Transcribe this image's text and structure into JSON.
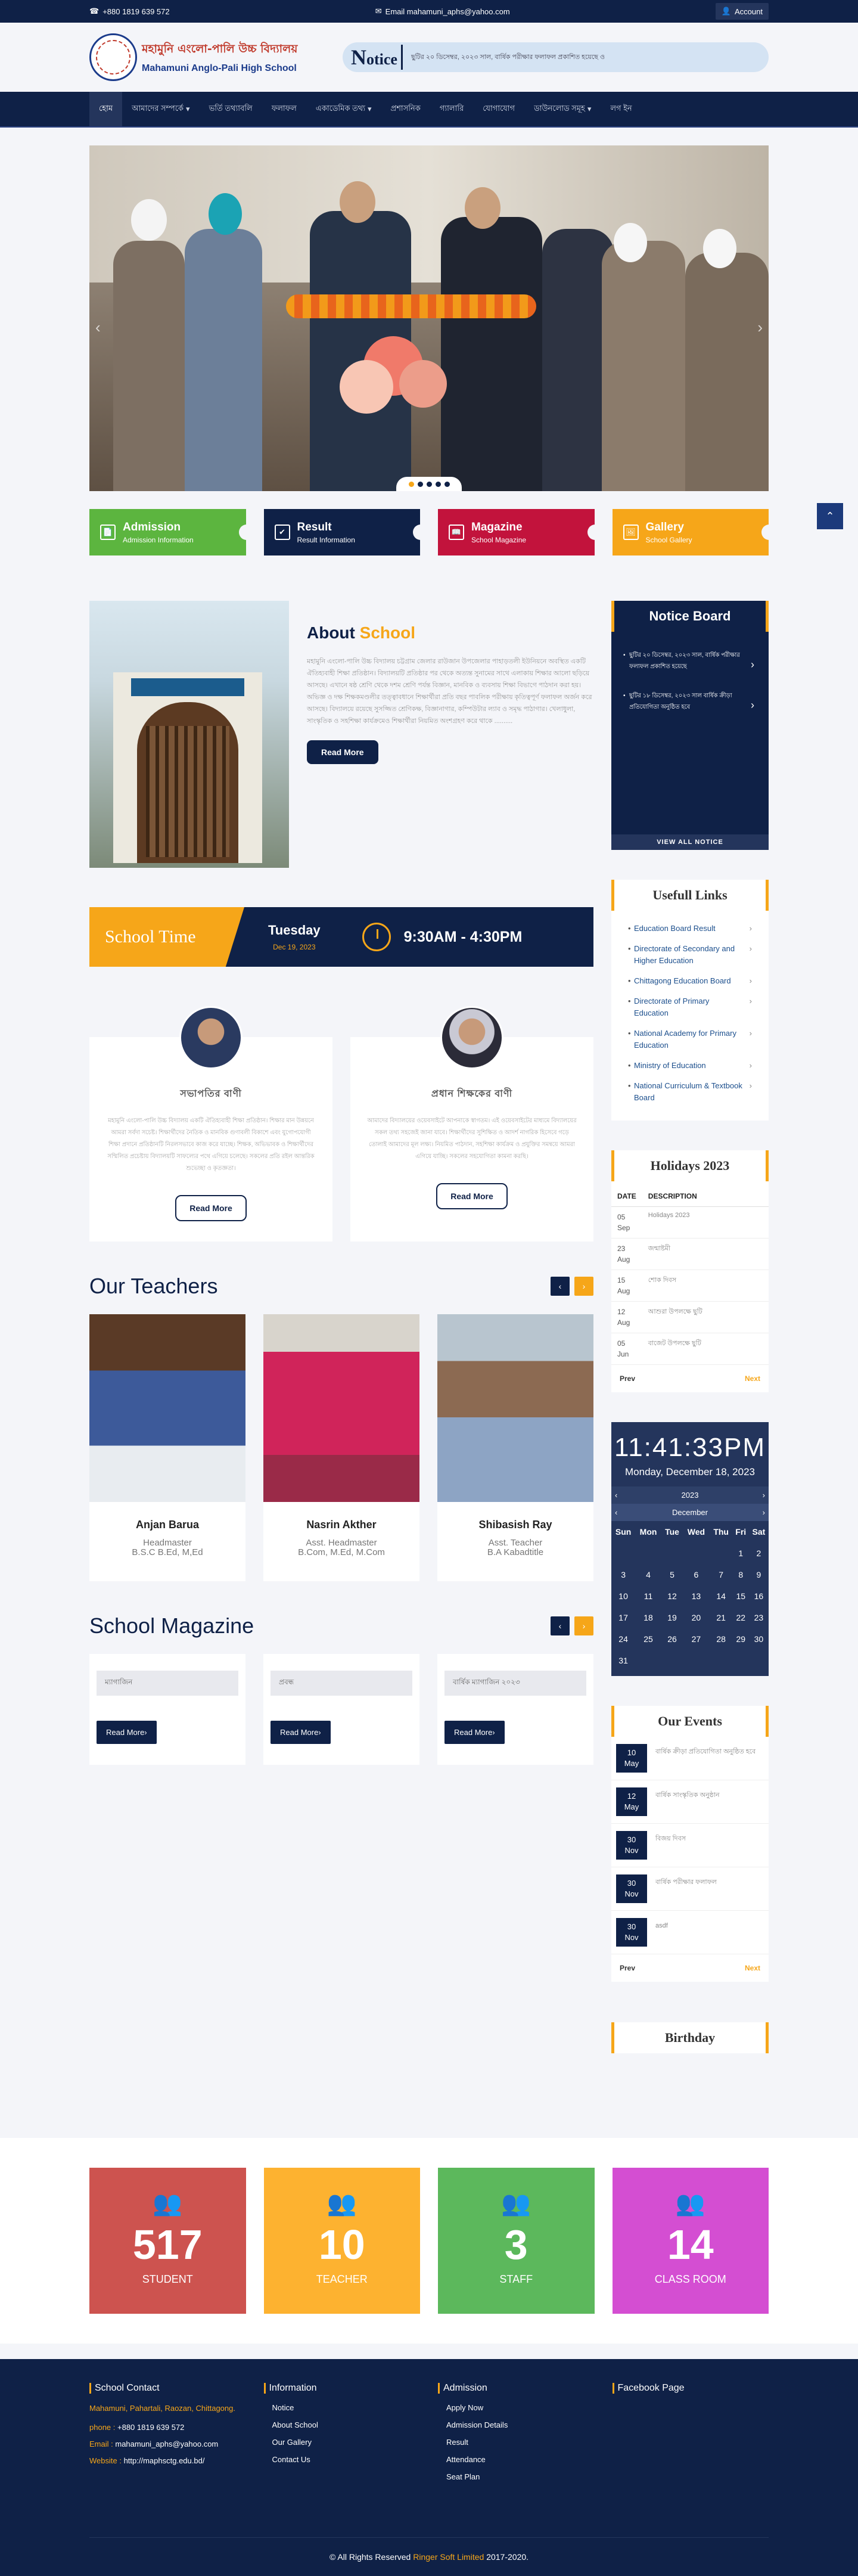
{
  "topbar": {
    "phone": "+880 1819 639 572",
    "email": "Email mahamuni_aphs@yahoo.com",
    "account": "Account"
  },
  "header": {
    "name_bn": "মহামুনি এংলো-পালি উচ্চ বিদ্যালয়",
    "name_en": "Mahamuni Anglo-Pali High School",
    "notice_label_big": "N",
    "notice_label_rest": "otice",
    "notice_ticker": "ছুটির ২০ ডিসেম্বর, ২০২৩ সাল, বার্ষিক পরীক্ষার ফলাফল প্রকাশিত হয়েছে ও"
  },
  "nav": [
    "হোম",
    "আমাদের সম্পর্কে",
    "ভর্তি তথ্যাবলি",
    "ফলাফল",
    "একাডেমিক তথ্য",
    "প্রশাসনিক",
    "গ্যালারি",
    "যোগাযোগ",
    "ডাউনলোড সমূহ",
    "লগ ইন"
  ],
  "nav_dropdowns": [
    false,
    true,
    false,
    false,
    true,
    false,
    false,
    false,
    true,
    false
  ],
  "quick_links": [
    {
      "title": "Admission",
      "sub": "Admission Information",
      "color": "#5cb53f",
      "icon": "📄"
    },
    {
      "title": "Result",
      "sub": "Result Information",
      "color": "#0f2147",
      "icon": "✔"
    },
    {
      "title": "Magazine",
      "sub": "School Magazine",
      "color": "#c2133c",
      "icon": "📖"
    },
    {
      "title": "Gallery",
      "sub": "School Gallery",
      "color": "#f6a619",
      "icon": "🖼"
    }
  ],
  "about": {
    "title_a": "About",
    "title_b": "School",
    "text": "মহামুনি এংলো-পালি উচ্চ বিদ্যালয় চট্টগ্রাম জেলার রাউজান উপজেলার পাহাড়তলী ইউনিয়নে অবস্থিত একটি ঐতিহ্যবাহী শিক্ষা প্রতিষ্ঠান। বিদ্যালয়টি প্রতিষ্ঠার পর থেকে অত্যন্ত সুনামের সাথে এলাকায় শিক্ষার আলো ছড়িয়ে আসছে। এখানে ষষ্ঠ শ্রেণি থেকে দশম শ্রেণি পর্যন্ত বিজ্ঞান, মানবিক ও ব্যবসায় শিক্ষা বিভাগে পাঠদান করা হয়। অভিজ্ঞ ও দক্ষ শিক্ষকমণ্ডলীর তত্ত্বাবধানে শিক্ষার্থীরা প্রতি বছর পাবলিক পরীক্ষায় কৃতিত্বপূর্ণ ফলাফল অর্জন করে আসছে। বিদ্যালয়ে রয়েছে সুসজ্জিত শ্রেণিকক্ষ, বিজ্ঞানাগার, কম্পিউটার ল্যাব ও সমৃদ্ধ পাঠাগার। খেলাধুলা, সাংস্কৃতিক ও সহশিক্ষা কার্যক্রমেও শিক্ষার্থীরা নিয়মিত অংশগ্রহণ করে থাকে ..........",
    "btn": "Read More"
  },
  "school_time": {
    "label": "School Time",
    "day": "Tuesday",
    "date": "Dec 19, 2023",
    "hours": "9:30AM - 4:30PM"
  },
  "messages": [
    {
      "name": "সভাপতির বাণী",
      "text": "মহামুনি এংলো-পালি উচ্চ বিদ্যালয় একটি ঐতিহ্যবাহী শিক্ষা প্রতিষ্ঠান। শিক্ষার মান উন্নয়নে আমরা সর্বদা সচেষ্ট। শিক্ষার্থীদের নৈতিক ও মানবিক গুণাবলী বিকাশে এবং যুগোপযোগী শিক্ষা প্রদানে প্রতিষ্ঠানটি নিরলসভাবে কাজ করে যাচ্ছে। শিক্ষক, অভিভাবক ও শিক্ষার্থীদের সম্মিলিত প্রচেষ্টায় বিদ্যালয়টি সাফল্যের পথে এগিয়ে চলেছে। সকলের প্রতি রইল আন্তরিক শুভেচ্ছা ও কৃতজ্ঞতা।",
      "btn": "Read More"
    },
    {
      "name": "প্রধান শিক্ষকের বাণী",
      "text": "আমাদের বিদ্যালয়ের ওয়েবসাইটে আপনাকে স্বাগতম। এই ওয়েবসাইটের মাধ্যমে বিদ্যালয়ের সকল তথ্য সহজেই জানা যাবে। শিক্ষার্থীদের সুশিক্ষিত ও আদর্শ নাগরিক হিসেবে গড়ে তোলাই আমাদের মূল লক্ষ্য। নিয়মিত পাঠদান, সহশিক্ষা কার্যক্রম ও প্রযুক্তির সমন্বয়ে আমরা এগিয়ে যাচ্ছি। সকলের সহযোগিতা কামনা করছি।",
      "btn": "Read More"
    }
  ],
  "teachers": {
    "title": "Our Teachers",
    "prev": "‹",
    "next": "›",
    "items": [
      {
        "name": "Anjan Barua",
        "designation": "Headmaster",
        "degree": "B.S.C B.Ed, M,Ed"
      },
      {
        "name": "Nasrin Akther",
        "designation": "Asst. Headmaster",
        "degree": "B.Com, M.Ed, M.Com"
      },
      {
        "name": "Shibasish Ray",
        "designation": "Asst. Teacher",
        "degree": "B.A Kabadtitle"
      }
    ]
  },
  "magazine": {
    "title": "School Magazine",
    "prev": "‹",
    "next": "›",
    "items": [
      {
        "title": "ম্যাগাজিন",
        "btn": "Read More›"
      },
      {
        "title": "প্রবন্ধ",
        "btn": "Read More›"
      },
      {
        "title": "বার্ষিক ম্যাগাজিন ২০২৩",
        "btn": "Read More›"
      }
    ]
  },
  "notice_board": {
    "title": "Notice Board",
    "items": [
      "ছুটির ২০ ডিসেম্বর, ২০২৩ সাল, বার্ষিক পরীক্ষার ফলাফল প্রকাশিত হয়েছে",
      "ছুটির ১৮ ডিসেম্বর, ২০২৩ সাল বার্ষিক ক্রীড়া প্রতিযোগিতা অনুষ্ঠিত হবে"
    ],
    "view_all": "VIEW ALL NOTICE"
  },
  "useful_links": {
    "title": "Usefull Links",
    "items": [
      "Education Board Result",
      "Directorate of Secondary and Higher Education",
      "Chittagong Education Board",
      "Directorate of Primary Education",
      "National Academy for Primary Education",
      "Ministry of Education",
      "National Curriculum & Textbook Board"
    ]
  },
  "holidays": {
    "title": "Holidays 2023",
    "col_date": "DATE",
    "col_desc": "DESCRIPTION",
    "rows": [
      {
        "day": "05",
        "mon": "Sep",
        "desc": "Holidays 2023"
      },
      {
        "day": "23",
        "mon": "Aug",
        "desc": "জন্মাষ্টমী"
      },
      {
        "day": "15",
        "mon": "Aug",
        "desc": "শোক দিবস"
      },
      {
        "day": "12",
        "mon": "Aug",
        "desc": "আশুরা উপলক্ষে ছুটি"
      },
      {
        "day": "05",
        "mon": "Jun",
        "desc": "বাজেট উপলক্ষে ছুটি"
      }
    ],
    "prev": "Prev",
    "next": "Next"
  },
  "clock": {
    "time": "11:41:33PM",
    "date": "Monday, December 18, 2023"
  },
  "calendar": {
    "year": "2023",
    "month": "December",
    "weekdays": [
      "Sun",
      "Mon",
      "Tue",
      "Wed",
      "Thu",
      "Fri",
      "Sat"
    ],
    "weeks": [
      [
        "",
        "",
        "",
        "",
        "",
        "1",
        "2"
      ],
      [
        "3",
        "4",
        "5",
        "6",
        "7",
        "8",
        "9"
      ],
      [
        "10",
        "11",
        "12",
        "13",
        "14",
        "15",
        "16"
      ],
      [
        "17",
        "18",
        "19",
        "20",
        "21",
        "22",
        "23"
      ],
      [
        "24",
        "25",
        "26",
        "27",
        "28",
        "29",
        "30"
      ],
      [
        "31",
        "",
        "",
        "",
        "",
        "",
        ""
      ]
    ]
  },
  "events": {
    "title": "Our Events",
    "items": [
      {
        "day": "10",
        "mon": "May",
        "text": "বার্ষিক ক্রীড়া প্রতিযোগিতা অনুষ্ঠিত হবে"
      },
      {
        "day": "12",
        "mon": "May",
        "text": "বার্ষিক সাংস্কৃতিক অনুষ্ঠান"
      },
      {
        "day": "30",
        "mon": "Nov",
        "text": "বিজয় দিবস"
      },
      {
        "day": "30",
        "mon": "Nov",
        "text": "বার্ষিক পরীক্ষার ফলাফল"
      },
      {
        "day": "30",
        "mon": "Nov",
        "text": "asdf"
      }
    ],
    "prev": "Prev",
    "next": "Next"
  },
  "birthday": {
    "title": "Birthday"
  },
  "stats": [
    {
      "num": "517",
      "label": "STUDENT",
      "color": "#cd534f"
    },
    {
      "num": "10",
      "label": "TEACHER",
      "color": "#fdb230"
    },
    {
      "num": "3",
      "label": "STAFF",
      "color": "#5cb85c"
    },
    {
      "num": "14",
      "label": "CLASS ROOM",
      "color": "#d44ed2"
    }
  ],
  "footer": {
    "contact_title": "School Contact",
    "address": "Mahamuni, Pahartali, Raozan, Chittagong.",
    "phone_label": "phone :",
    "phone": "+880 1819 639 572",
    "email_label": "Email :",
    "email": "mahamuni_aphs@yahoo.com",
    "web_label": "Website :",
    "web": "http://maphsctg.edu.bd/",
    "info_title": "Information",
    "info_links": [
      "Notice",
      "About School",
      "Our Gallery",
      "Contact Us"
    ],
    "adm_title": "Admission",
    "adm_links": [
      "Apply Now",
      "Admission Details",
      "Result",
      "Attendance",
      "Seat Plan"
    ],
    "fb_title": "Facebook Page",
    "copy_a": "© All Rights Reserved",
    "copy_b": "Ringer Soft Limited",
    "copy_c": "2017-2020."
  }
}
